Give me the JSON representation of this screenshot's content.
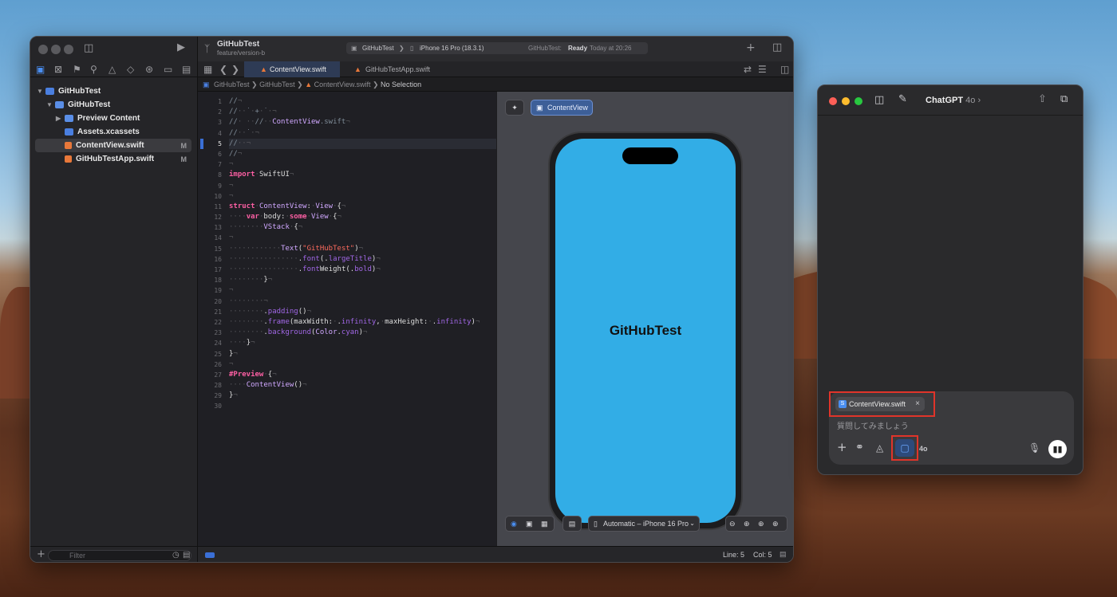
{
  "xcode": {
    "project_name": "GitHubTest",
    "branch": "feature/version-b",
    "scheme": "GitHubTest",
    "device": "iPhone 16 Pro (18.3.1)",
    "status_app": "GitHubTest:",
    "status_state": "Ready",
    "status_time": "Today at 20:26",
    "navigator": {
      "items": [
        {
          "label": "GitHubTest",
          "badge": ""
        },
        {
          "label": "GitHubTest",
          "badge": ""
        },
        {
          "label": "Preview Content",
          "badge": ""
        },
        {
          "label": "Assets.xcassets",
          "badge": ""
        },
        {
          "label": "ContentView.swift",
          "badge": "M"
        },
        {
          "label": "GitHubTestApp.swift",
          "badge": "M"
        }
      ],
      "filter_placeholder": "Filter"
    },
    "tabs": [
      {
        "label": "ContentView.swift"
      },
      {
        "label": "GitHubTestApp.swift"
      }
    ],
    "breadcrumb": {
      "project": "GitHubTest",
      "group": "GitHubTest",
      "file": "ContentView.swift",
      "selection": "No Selection"
    },
    "code_lines": [
      {
        "num": "1",
        "text": "//¬"
      },
      {
        "num": "2",
        "text": "//··˙·+·˙·¬"
      },
      {
        "num": "3",
        "text": "//· ··//··ContentView.swift¬"
      },
      {
        "num": "4",
        "text": "//··˙·¬"
      },
      {
        "num": "5",
        "text": "//··¬"
      },
      {
        "num": "6",
        "text": "//¬"
      },
      {
        "num": "7",
        "text": "¬"
      },
      {
        "num": "8",
        "text": "import·SwiftUI¬"
      },
      {
        "num": "9",
        "text": "¬"
      },
      {
        "num": "10",
        "text": "¬"
      },
      {
        "num": "11",
        "text": "struct·ContentView:·View·{¬"
      },
      {
        "num": "12",
        "text": "····var·body:·some·View·{¬"
      },
      {
        "num": "13",
        "text": "········VStack·{¬"
      },
      {
        "num": "14",
        "text": "¬"
      },
      {
        "num": "15",
        "text": "············Text(\"GitHubTest\")¬"
      },
      {
        "num": "16",
        "text": "················.font(.largeTitle)¬"
      },
      {
        "num": "17",
        "text": "················.fontWeight(.bold)¬"
      },
      {
        "num": "18",
        "text": "········}¬"
      },
      {
        "num": "19",
        "text": "¬"
      },
      {
        "num": "20",
        "text": "········¬"
      },
      {
        "num": "21",
        "text": "········.padding()¬"
      },
      {
        "num": "22",
        "text": "········.frame(maxWidth:·.infinity,·maxHeight:·.infinity)¬"
      },
      {
        "num": "23",
        "text": "········.background(Color.cyan)¬"
      },
      {
        "num": "24",
        "text": "····}¬"
      },
      {
        "num": "25",
        "text": "}¬"
      },
      {
        "num": "26",
        "text": "¬"
      },
      {
        "num": "27",
        "text": "#Preview·{¬"
      },
      {
        "num": "28",
        "text": "····ContentView()¬"
      },
      {
        "num": "29",
        "text": "}¬"
      },
      {
        "num": "30",
        "text": ""
      }
    ],
    "preview": {
      "pin_label": "ContentView",
      "app_text": "GitHubTest",
      "device_select": "Automatic – iPhone 16 Pro",
      "screen_color": "#32ade6"
    },
    "status_bar": {
      "line": "Line: 5",
      "col": "Col: 5"
    }
  },
  "chatgpt": {
    "title": "ChatGPT",
    "model": "4o",
    "attachment": "ContentView.swift",
    "placeholder": "質問してみましょう",
    "model_button": "4o"
  },
  "colors": {
    "highlight": "#e0342a",
    "accent": "#3a6fd6"
  }
}
